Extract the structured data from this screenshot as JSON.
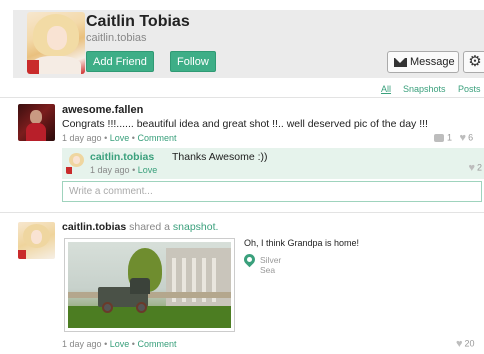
{
  "profile": {
    "name": "Caitlin Tobias",
    "handle": "caitlin.tobias",
    "add_friend_label": "Add Friend",
    "follow_label": "Follow",
    "message_label": "Message",
    "settings_icon": "gear-icon",
    "message_icon": "envelope-icon"
  },
  "filters": {
    "all": "All",
    "snapshots": "Snapshots",
    "posts": "Posts"
  },
  "post1": {
    "author": "awesome.fallen",
    "text": "Congrats !!!...... beautiful idea and great shot !!.. well deserved pic of the day !!!",
    "time": "1 day ago",
    "dot1": "•",
    "love": "Love",
    "dot2": "•",
    "comment": "Comment",
    "comment_count": "1",
    "like_count": "6"
  },
  "reply": {
    "author": "caitlin.tobias",
    "text": "Thanks Awesome :))",
    "time": "1 day ago",
    "dot": "•",
    "love": "Love",
    "like_count": "2"
  },
  "comment_box": {
    "placeholder": "Write a comment..."
  },
  "post2": {
    "author": "caitlin.tobias",
    "shared_text": "shared a",
    "shared_link": "snapshot.",
    "caption": "Oh, I think Grandpa is home!",
    "location_line1": "Silver",
    "location_line2": "Sea",
    "time": "1 day ago",
    "dot1": "•",
    "love": "Love",
    "dot2": "•",
    "comment": "Comment",
    "like_count": "20"
  },
  "colors": {
    "accent": "#3eae87",
    "header_bg": "#ebebeb",
    "reply_bg": "#e6f3ec"
  }
}
